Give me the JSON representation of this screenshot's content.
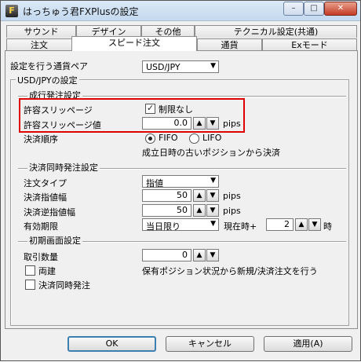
{
  "window": {
    "title": "はっちゅう君FXPlusの設定",
    "icon": "app-icon",
    "controls": {
      "minimize": "–",
      "maximize": "□",
      "close": "✕"
    }
  },
  "tabs_row1": [
    "サウンド",
    "デザイン",
    "その他",
    "テクニカル設定(共通)"
  ],
  "tabs_row2": [
    "注文",
    "スピード注文",
    "通貨",
    "Exモード"
  ],
  "active_tab": "スピード注文",
  "pair": {
    "label": "設定を行う通貨ペア",
    "value": "USD/JPY"
  },
  "group_title": "USD/JPYの設定",
  "market_order": {
    "header": "成行発注設定",
    "slippage_label": "許容スリッページ",
    "unlimited_label": "制限なし",
    "unlimited_checked": true,
    "slippage_value_label": "許容スリッページ値",
    "slippage_value": "0.0",
    "unit": "pips",
    "settle_order_label": "決済順序",
    "fifo_label": "FIFO",
    "lifo_label": "LIFO",
    "selected": "FIFO",
    "note": "成立日時の古いポジションから決済"
  },
  "simultaneous": {
    "header": "決済同時発注設定",
    "order_type_label": "注文タイプ",
    "order_type_value": "指値",
    "limit_label": "決済指値幅",
    "limit_value": "50",
    "stop_label": "決済逆指値幅",
    "stop_value": "50",
    "unit": "pips",
    "expiry_label": "有効期限",
    "expiry_value": "当日限り",
    "current_time_label": "現在時+",
    "hours_value": "2",
    "hours_unit": "時"
  },
  "initial": {
    "header": "初期画面設定",
    "qty_label": "取引数量",
    "qty_value": "0",
    "both_label": "両建",
    "both_note": "保有ポジション状況から新規/決済注文を行う",
    "both_checked": false,
    "sim_label": "決済同時発注",
    "sim_checked": false
  },
  "buttons": {
    "ok": "OK",
    "cancel": "キャンセル",
    "apply": "適用(A)"
  },
  "spin": {
    "up": "▲",
    "down": "▼"
  },
  "combo_arrow": "▼"
}
